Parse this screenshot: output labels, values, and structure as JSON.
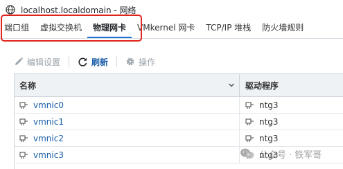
{
  "window": {
    "title": "localhost.localdomain - 网络"
  },
  "tabs": [
    {
      "label": "端口组",
      "active": false
    },
    {
      "label": "虚拟交换机",
      "active": false
    },
    {
      "label": "物理网卡",
      "active": true
    },
    {
      "label": "VMkernel 网卡",
      "active": false
    },
    {
      "label": "TCP/IP 堆栈",
      "active": false
    },
    {
      "label": "防火墙规则",
      "active": false
    }
  ],
  "toolbar": {
    "edit_label": "编辑设置",
    "refresh_label": "刷新",
    "actions_label": "操作"
  },
  "table": {
    "columns": [
      "名称",
      "驱动程序"
    ],
    "rows": [
      {
        "name": "vmnic0",
        "driver": "ntg3"
      },
      {
        "name": "vmnic1",
        "driver": "ntg3"
      },
      {
        "name": "vmnic2",
        "driver": "ntg3"
      },
      {
        "name": "vmnic3",
        "driver": "ntg3"
      }
    ]
  },
  "watermark": {
    "text": "公众号 · 铁军哥"
  },
  "colors": {
    "accent": "#1a73d1",
    "link": "#1a5ea8",
    "highlight_box": "#e0231c"
  },
  "icons": [
    "network-globe-icon",
    "pencil-icon",
    "refresh-icon",
    "gear-icon",
    "sort-chevron-icon",
    "physical-nic-icon",
    "wechat-logo-icon"
  ]
}
